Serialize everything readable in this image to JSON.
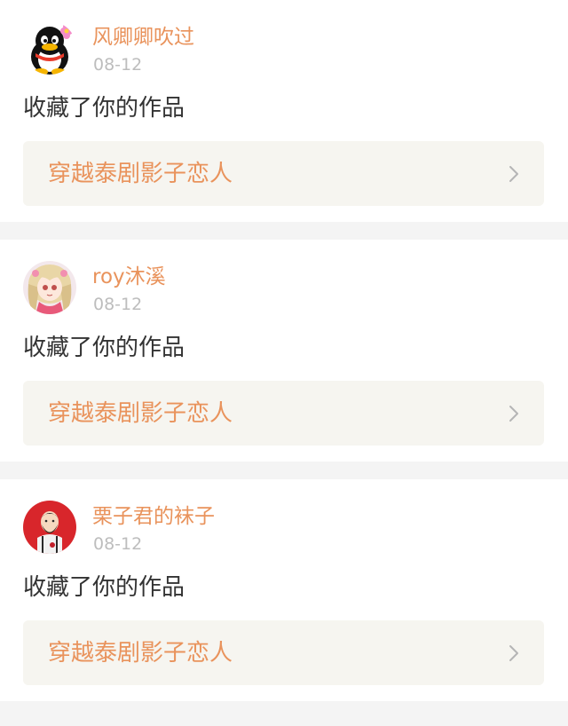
{
  "notifications": [
    {
      "username": "风卿卿吹过",
      "date": "08-12",
      "action": "收藏了你的作品",
      "work_title": "穿越泰剧影子恋人",
      "avatar_icon": "penguin-avatar-icon"
    },
    {
      "username": "roy沐溪",
      "date": "08-12",
      "action": "收藏了你的作品",
      "work_title": "穿越泰剧影子恋人",
      "avatar_icon": "anime-girl-avatar-icon"
    },
    {
      "username": "栗子君的袜子",
      "date": "08-12",
      "action": "收藏了你的作品",
      "work_title": "穿越泰剧影子恋人",
      "avatar_icon": "bearded-man-avatar-icon"
    }
  ],
  "colors": {
    "accent": "#e9935c",
    "text": "#333333",
    "muted": "#bdbdbd",
    "link_bg": "#f6f5f0",
    "page_bg": "#f4f4f4"
  }
}
